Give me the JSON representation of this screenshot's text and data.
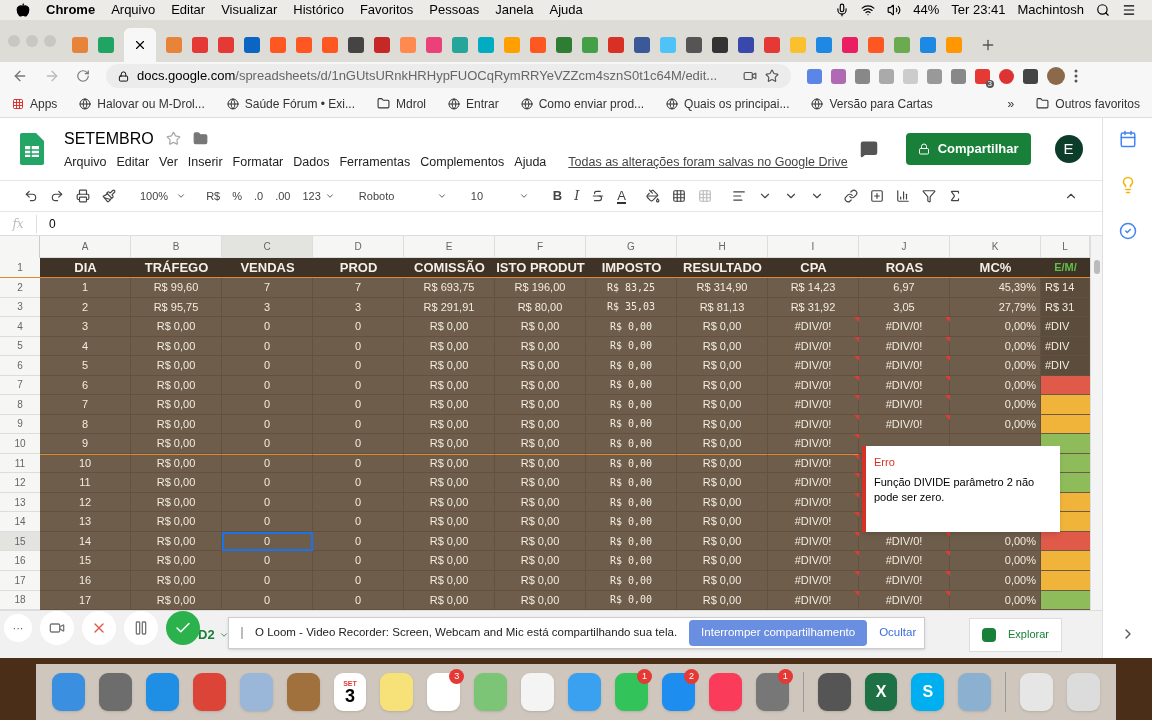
{
  "menubar": {
    "app": "Chrome",
    "items": [
      "Arquivo",
      "Editar",
      "Visualizar",
      "Histórico",
      "Favoritos",
      "Pessoas",
      "Janela",
      "Ajuda"
    ],
    "battery": "44%",
    "clock": "Ter 23:41",
    "user": "Machintosh"
  },
  "address": {
    "domain": "docs.google.com",
    "path": "/spreadsheets/d/1nGUtsURnkHRHypFUOCqRymRRYeVZZcm4sznS0t1c64M/edit...",
    "ext_badge": "3"
  },
  "bookmarks": [
    "Apps",
    "Halovar ou M-Drol...",
    "Saúde Fórum • Exi...",
    "Mdrol",
    "Entrar",
    "Como enviar prod...",
    "Quais os principai...",
    "Versão para Cartas"
  ],
  "bookmarks_more": "»",
  "other_bookmarks": "Outros favoritos",
  "doc": {
    "title": "SETEMBRO",
    "menus": [
      "Arquivo",
      "Editar",
      "Ver",
      "Inserir",
      "Formatar",
      "Dados",
      "Ferramentas",
      "Complementos",
      "Ajuda"
    ],
    "saved": "Todas as alterações foram salvas no Google Drive",
    "share": "Compartilhar",
    "avatar": "E"
  },
  "toolbar": {
    "zoom": "100%",
    "currency": "R$",
    "percent": "%",
    "dec_less": ".0",
    "dec_more": ".00",
    "format": "123",
    "font": "Roboto",
    "size": "10",
    "bold": "B",
    "italic": "I",
    "font_letter": "A"
  },
  "formula": {
    "fx": "fx",
    "value": "0"
  },
  "columns": [
    {
      "letter": "A",
      "title": "DIA",
      "selected": false
    },
    {
      "letter": "B",
      "title": "TRÁFEGO",
      "selected": false
    },
    {
      "letter": "C",
      "title": "VENDAS",
      "selected": true
    },
    {
      "letter": "D",
      "title": "PROD",
      "selected": false
    },
    {
      "letter": "E",
      "title": "COMISSÃO",
      "selected": false
    },
    {
      "letter": "F",
      "title": "ISTO PRODUT",
      "selected": false
    },
    {
      "letter": "G",
      "title": "IMPOSTO",
      "selected": false
    },
    {
      "letter": "H",
      "title": "RESULTADO",
      "selected": false
    },
    {
      "letter": "I",
      "title": "CPA",
      "selected": false
    },
    {
      "letter": "J",
      "title": "ROAS",
      "selected": false
    },
    {
      "letter": "K",
      "title": "MC%",
      "selected": false
    },
    {
      "letter": "L",
      "title": "E/M/",
      "selected": false
    }
  ],
  "header_row": "1",
  "rows": [
    {
      "num": "2",
      "error": false,
      "selected": false,
      "cells": [
        "1",
        "R$ 99,60",
        "7",
        "7",
        "R$ 693,75",
        "R$ 196,00",
        "R$ 83,25",
        "R$ 314,90",
        "R$ 14,23",
        "6,97",
        "45,39%",
        "R$ 14"
      ]
    },
    {
      "num": "3",
      "error": false,
      "selected": false,
      "cells": [
        "2",
        "R$ 95,75",
        "3",
        "3",
        "R$ 291,91",
        "R$ 80,00",
        "R$ 35,03",
        "R$ 81,13",
        "R$ 31,92",
        "3,05",
        "27,79%",
        "R$ 31"
      ]
    },
    {
      "num": "4",
      "error": true,
      "selected": false,
      "cells": [
        "3",
        "R$ 0,00",
        "0",
        "0",
        "R$ 0,00",
        "R$ 0,00",
        "R$ 0,00",
        "R$ 0,00",
        "#DIV/0!",
        "#DIV/0!",
        "0,00%",
        "#DIV"
      ]
    },
    {
      "num": "5",
      "error": true,
      "selected": false,
      "cells": [
        "4",
        "R$ 0,00",
        "0",
        "0",
        "R$ 0,00",
        "R$ 0,00",
        "R$ 0,00",
        "R$ 0,00",
        "#DIV/0!",
        "#DIV/0!",
        "0,00%",
        "#DIV"
      ]
    },
    {
      "num": "6",
      "error": true,
      "selected": false,
      "cells": [
        "5",
        "R$ 0,00",
        "0",
        "0",
        "R$ 0,00",
        "R$ 0,00",
        "R$ 0,00",
        "R$ 0,00",
        "#DIV/0!",
        "#DIV/0!",
        "0,00%",
        "#DIV"
      ]
    },
    {
      "num": "7",
      "error": true,
      "selected": false,
      "color": "#e05a4a",
      "cells": [
        "6",
        "R$ 0,00",
        "0",
        "0",
        "R$ 0,00",
        "R$ 0,00",
        "R$ 0,00",
        "R$ 0,00",
        "#DIV/0!",
        "#DIV/0!",
        "0,00%"
      ]
    },
    {
      "num": "8",
      "error": true,
      "selected": false,
      "color": "#f0b43a",
      "cells": [
        "7",
        "R$ 0,00",
        "0",
        "0",
        "R$ 0,00",
        "R$ 0,00",
        "R$ 0,00",
        "R$ 0,00",
        "#DIV/0!",
        "#DIV/0!",
        "0,00%"
      ]
    },
    {
      "num": "9",
      "error": true,
      "selected": false,
      "color": "#f0b43a",
      "cells": [
        "8",
        "R$ 0,00",
        "0",
        "0",
        "R$ 0,00",
        "R$ 0,00",
        "R$ 0,00",
        "R$ 0,00",
        "#DIV/0!",
        "#DIV/0!",
        "0,00%"
      ]
    },
    {
      "num": "10",
      "error": true,
      "selected": false,
      "color": "#8fbc5a",
      "cells": [
        "9",
        "R$ 0,00",
        "0",
        "0",
        "R$ 0,00",
        "R$ 0,00",
        "R$ 0,00",
        "R$ 0,00",
        "#DIV/0!"
      ]
    },
    {
      "num": "11",
      "error": true,
      "selected": false,
      "rule_above": true,
      "color": "#8fbc5a",
      "cells": [
        "10",
        "R$ 0,00",
        "0",
        "0",
        "R$ 0,00",
        "R$ 0,00",
        "R$ 0,00",
        "R$ 0,00",
        "#DIV/0!"
      ]
    },
    {
      "num": "12",
      "error": true,
      "selected": false,
      "color": "#8fbc5a",
      "cells": [
        "11",
        "R$ 0,00",
        "0",
        "0",
        "R$ 0,00",
        "R$ 0,00",
        "R$ 0,00",
        "R$ 0,00",
        "#DIV/0!"
      ]
    },
    {
      "num": "13",
      "error": true,
      "selected": false,
      "color": "#f0b43a",
      "cells": [
        "12",
        "R$ 0,00",
        "0",
        "0",
        "R$ 0,00",
        "R$ 0,00",
        "R$ 0,00",
        "R$ 0,00",
        "#DIV/0!"
      ]
    },
    {
      "num": "14",
      "error": true,
      "selected": false,
      "color": "#f0b43a",
      "cells": [
        "13",
        "R$ 0,00",
        "0",
        "0",
        "R$ 0,00",
        "R$ 0,00",
        "R$ 0,00",
        "R$ 0,00",
        "#DIV/0!"
      ]
    },
    {
      "num": "15",
      "error": true,
      "selected": true,
      "color": "#e05a4a",
      "cells": [
        "14",
        "R$ 0,00",
        "0",
        "0",
        "R$ 0,00",
        "R$ 0,00",
        "R$ 0,00",
        "R$ 0,00",
        "#DIV/0!",
        "#DIV/0!",
        "0,00%"
      ]
    },
    {
      "num": "16",
      "error": true,
      "selected": false,
      "color": "#f0b43a",
      "cells": [
        "15",
        "R$ 0,00",
        "0",
        "0",
        "R$ 0,00",
        "R$ 0,00",
        "R$ 0,00",
        "R$ 0,00",
        "#DIV/0!",
        "#DIV/0!",
        "0,00%"
      ]
    },
    {
      "num": "17",
      "error": true,
      "selected": false,
      "color": "#f0b43a",
      "cells": [
        "16",
        "R$ 0,00",
        "0",
        "0",
        "R$ 0,00",
        "R$ 0,00",
        "R$ 0,00",
        "R$ 0,00",
        "#DIV/0!",
        "#DIV/0!",
        "0,00%"
      ]
    },
    {
      "num": "18",
      "error": true,
      "selected": false,
      "color": "#8fbc5a",
      "cells": [
        "17",
        "R$ 0,00",
        "0",
        "0",
        "R$ 0,00",
        "R$ 0,00",
        "R$ 0,00",
        "R$ 0,00",
        "#DIV/0!",
        "#DIV/0!",
        "0,00%"
      ]
    }
  ],
  "tooltip": {
    "title": "Erro",
    "message": "Função DIVIDE parâmetro 2 não pode ser zero."
  },
  "sheetbar": {
    "tab": "D2",
    "explore": "Explorar"
  },
  "loom": {
    "message": "O Loom - Video Recorder: Screen, Webcam and Mic está compartilhando sua tela.",
    "stop": "Interromper compartilhamento",
    "hide": "Ocultar",
    "more": "···"
  },
  "dock": [
    {
      "kind": "finder"
    },
    {
      "kind": "rocket"
    },
    {
      "kind": "compass"
    },
    {
      "kind": "chrome"
    },
    {
      "kind": "bird"
    },
    {
      "kind": "book"
    },
    {
      "kind": "calendar",
      "month": "SET",
      "day": "3"
    },
    {
      "kind": "notes"
    },
    {
      "kind": "list",
      "badge": "3"
    },
    {
      "kind": "map"
    },
    {
      "kind": "photos"
    },
    {
      "kind": "chat"
    },
    {
      "kind": "video",
      "badge": "1"
    },
    {
      "kind": "store",
      "badge": "2"
    },
    {
      "kind": "music"
    },
    {
      "kind": "gear",
      "badge": "1"
    },
    {
      "kind": "calculator"
    },
    {
      "kind": "excel",
      "letter": "X"
    },
    {
      "kind": "skype",
      "letter": "S"
    },
    {
      "kind": "photo"
    },
    {
      "kind": "window"
    },
    {
      "kind": "trash"
    }
  ]
}
